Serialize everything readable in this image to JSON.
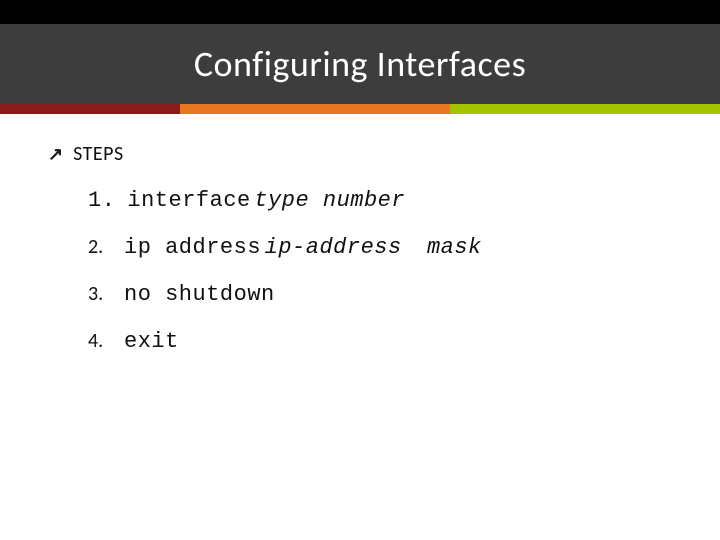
{
  "header": {
    "title": "Configuring Interfaces",
    "stripe_colors": {
      "maroon": "#8b1a1a",
      "orange": "#e87722",
      "lime": "#a4c400"
    }
  },
  "content": {
    "section_label": "STEPS",
    "steps": [
      {
        "num": "1.",
        "command": "interface",
        "args_italic": "type  number",
        "args_trailing": ""
      },
      {
        "num": "2.",
        "command": "ip address",
        "args_italic": "ip-address",
        "args_trailing": "mask"
      },
      {
        "num": "3.",
        "command": "no shutdown",
        "args_italic": "",
        "args_trailing": ""
      },
      {
        "num": "4.",
        "command": "exit",
        "args_italic": "",
        "args_trailing": ""
      }
    ]
  }
}
